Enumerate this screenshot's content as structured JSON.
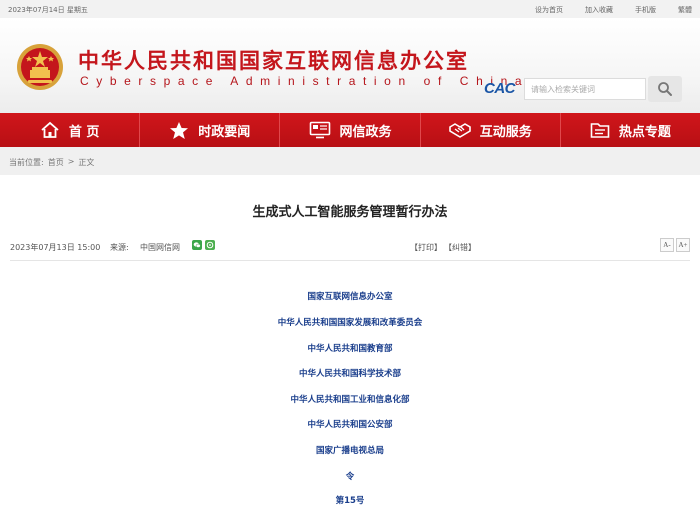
{
  "topbar": {
    "date": "2023年07月14日 星期五",
    "links": [
      "设为首页",
      "加入收藏",
      "手机版",
      "繁體"
    ]
  },
  "header": {
    "title": "中华人民共和国国家互联网信息办公室",
    "subtitle": "Cyberspace Administration of China",
    "logo_text": "CAC",
    "search_placeholder": "请输入检索关键词"
  },
  "nav": {
    "items": [
      {
        "label": "首 页",
        "icon": "home-icon"
      },
      {
        "label": "时政要闻",
        "icon": "star-icon"
      },
      {
        "label": "网信政务",
        "icon": "monitor-icon"
      },
      {
        "label": "互动服务",
        "icon": "handshake-icon"
      },
      {
        "label": "热点专题",
        "icon": "folder-icon"
      }
    ]
  },
  "breadcrumb": {
    "label": "当前位置:",
    "home": "首页",
    "sep": ">",
    "current": "正文"
  },
  "article": {
    "title": "生成式人工智能服务管理暂行办法",
    "date": "2023年07月13日 15:00",
    "source_label": "来源:",
    "source": "中国网信网",
    "print": "【打印】",
    "correct": "【纠错】",
    "font_smaller": "A-",
    "font_larger": "A+",
    "orgs": [
      "国家互联网信息办公室",
      "中华人民共和国国家发展和改革委员会",
      "中华人民共和国教育部",
      "中华人民共和国科学技术部",
      "中华人民共和国工业和信息化部",
      "中华人民共和国公安部",
      "国家广播电视总局",
      "令",
      "第15号"
    ]
  },
  "colors": {
    "brand_red": "#c4161c",
    "nav_red": "#c8131a",
    "link_blue": "#1a3e8c"
  }
}
